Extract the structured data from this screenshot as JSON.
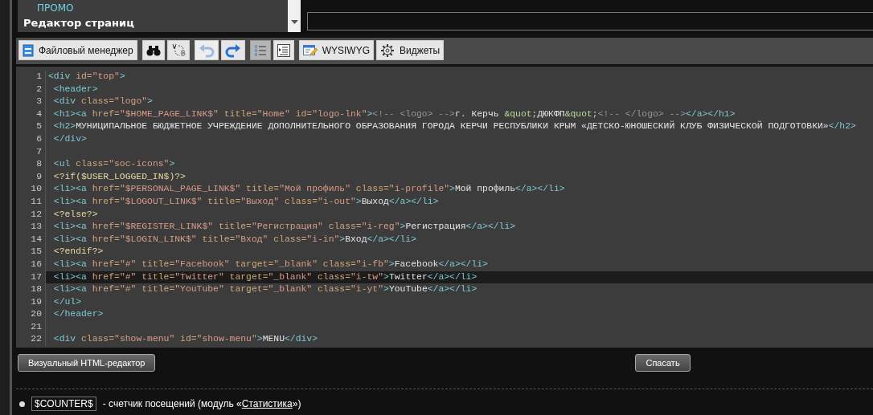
{
  "sidebar": {
    "items": [
      {
        "label": "ПРОМО",
        "kind": "link"
      },
      {
        "label": "Редактор страниц",
        "kind": "heading"
      }
    ]
  },
  "toolbar": [
    [
      {
        "label": "Файловый менеджер",
        "disabled": false,
        "pressed": false
      }
    ],
    [
      {
        "disabled": false,
        "pressed": false
      },
      {
        "disabled": false,
        "pressed": false
      }
    ],
    [
      {
        "disabled": true,
        "pressed": false
      },
      {
        "disabled": false,
        "pressed": false
      }
    ],
    [
      {
        "disabled": false,
        "pressed": true
      },
      {
        "disabled": false,
        "pressed": false
      }
    ],
    [
      {
        "label": "WYSIWYG",
        "disabled": false,
        "pressed": false
      },
      {
        "label": "Виджеты",
        "disabled": false,
        "pressed": false
      }
    ]
  ],
  "editor": {
    "lines": [
      {
        "number": "1",
        "selected": false,
        "tokens": [
          {
            "kind": "tag",
            "text": "<div"
          },
          {
            "kind": "attr",
            "text": " id="
          },
          {
            "kind": "string",
            "text": "\"top\""
          },
          {
            "kind": "tag",
            "text": ">"
          }
        ]
      },
      {
        "number": "2",
        "selected": false,
        "tokens": [
          {
            "kind": "tag",
            "text": " <header>"
          }
        ]
      },
      {
        "number": "3",
        "selected": false,
        "tokens": [
          {
            "kind": "tag",
            "text": " <div"
          },
          {
            "kind": "attr",
            "text": " class="
          },
          {
            "kind": "string",
            "text": "\"logo\""
          },
          {
            "kind": "tag",
            "text": ">"
          }
        ]
      },
      {
        "number": "4",
        "selected": false,
        "tokens": [
          {
            "kind": "tag",
            "text": " <h1><a"
          },
          {
            "kind": "attr",
            "text": " href="
          },
          {
            "kind": "string",
            "text": "\"$HOME_PAGE_LINK$\""
          },
          {
            "kind": "attr",
            "text": " title="
          },
          {
            "kind": "string",
            "text": "\"Home\""
          },
          {
            "kind": "attr",
            "text": " id="
          },
          {
            "kind": "string",
            "text": "\"logo-lnk\""
          },
          {
            "kind": "tag",
            "text": ">"
          },
          {
            "kind": "comment",
            "text": "<!-- <logo> -->"
          },
          {
            "kind": "text",
            "text": "г. Керчь "
          },
          {
            "kind": "entity",
            "text": "&quot;"
          },
          {
            "kind": "text",
            "text": "ДЮКФП"
          },
          {
            "kind": "entity",
            "text": "&quot;"
          },
          {
            "kind": "comment",
            "text": "<!-- </logo> -->"
          },
          {
            "kind": "tag",
            "text": "</a></h1>"
          }
        ]
      },
      {
        "number": "5",
        "selected": false,
        "tokens": [
          {
            "kind": "tag",
            "text": " <h2>"
          },
          {
            "kind": "text",
            "text": "МУНИЦИПАЛЬНОЕ БЮДЖЕТНОЕ УЧРЕЖДЕНИЕ ДОПОЛНИТЕЛЬНОГО ОБРАЗОВАНИЯ ГОРОДА КЕРЧИ РЕСПУБЛИКИ КРЫМ «ДЕТСКО-ЮНОШЕСКИЙ КЛУБ ФИЗИЧЕСКОЙ ПОДГОТОВКИ»"
          },
          {
            "kind": "tag",
            "text": "</h2>"
          }
        ]
      },
      {
        "number": "6",
        "selected": false,
        "tokens": [
          {
            "kind": "tag",
            "text": " </div>"
          }
        ]
      },
      {
        "number": "7",
        "selected": false
      },
      {
        "number": "8",
        "selected": false,
        "tokens": [
          {
            "kind": "tag",
            "text": " <ul"
          },
          {
            "kind": "attr",
            "text": " class="
          },
          {
            "kind": "string",
            "text": "\"soc-icons\""
          },
          {
            "kind": "tag",
            "text": ">"
          }
        ]
      },
      {
        "number": "9",
        "selected": false,
        "tokens": [
          {
            "kind": "php",
            "text": " <?if($USER_LOGGED_IN$)?>"
          }
        ]
      },
      {
        "number": "10",
        "selected": false,
        "tokens": [
          {
            "kind": "tag",
            "text": " <li><a"
          },
          {
            "kind": "attr",
            "text": " href="
          },
          {
            "kind": "string",
            "text": "\"$PERSONAL_PAGE_LINK$\""
          },
          {
            "kind": "attr",
            "text": " title="
          },
          {
            "kind": "string",
            "text": "\"Мой профиль\""
          },
          {
            "kind": "attr",
            "text": " class="
          },
          {
            "kind": "string",
            "text": "\"i-profile\""
          },
          {
            "kind": "tag",
            "text": ">"
          },
          {
            "kind": "text",
            "text": "Мой профиль"
          },
          {
            "kind": "tag",
            "text": "</a></li>"
          }
        ]
      },
      {
        "number": "11",
        "selected": false,
        "tokens": [
          {
            "kind": "tag",
            "text": " <li><a"
          },
          {
            "kind": "attr",
            "text": " href="
          },
          {
            "kind": "string",
            "text": "\"$LOGOUT_LINK$\""
          },
          {
            "kind": "attr",
            "text": " title="
          },
          {
            "kind": "string",
            "text": "\"Выход\""
          },
          {
            "kind": "attr",
            "text": " class="
          },
          {
            "kind": "string",
            "text": "\"i-out\""
          },
          {
            "kind": "tag",
            "text": ">"
          },
          {
            "kind": "text",
            "text": "Выход"
          },
          {
            "kind": "tag",
            "text": "</a></li>"
          }
        ]
      },
      {
        "number": "12",
        "selected": false,
        "tokens": [
          {
            "kind": "php",
            "text": " <?else?>"
          }
        ]
      },
      {
        "number": "13",
        "selected": false,
        "tokens": [
          {
            "kind": "tag",
            "text": " <li><a"
          },
          {
            "kind": "attr",
            "text": " href="
          },
          {
            "kind": "string",
            "text": "\"$REGISTER_LINK$\""
          },
          {
            "kind": "attr",
            "text": " title="
          },
          {
            "kind": "string",
            "text": "\"Регистрация\""
          },
          {
            "kind": "attr",
            "text": " class="
          },
          {
            "kind": "string",
            "text": "\"i-reg\""
          },
          {
            "kind": "tag",
            "text": ">"
          },
          {
            "kind": "text",
            "text": "Регистрация"
          },
          {
            "kind": "tag",
            "text": "</a></li>"
          }
        ]
      },
      {
        "number": "14",
        "selected": false,
        "tokens": [
          {
            "kind": "tag",
            "text": " <li><a"
          },
          {
            "kind": "attr",
            "text": " href="
          },
          {
            "kind": "string",
            "text": "\"$LOGIN_LINK$\""
          },
          {
            "kind": "attr",
            "text": " title="
          },
          {
            "kind": "string",
            "text": "\"Вход\""
          },
          {
            "kind": "attr",
            "text": " class="
          },
          {
            "kind": "string",
            "text": "\"i-in\""
          },
          {
            "kind": "tag",
            "text": ">"
          },
          {
            "kind": "text",
            "text": "Вход"
          },
          {
            "kind": "tag",
            "text": "</a></li>"
          }
        ]
      },
      {
        "number": "15",
        "selected": false,
        "tokens": [
          {
            "kind": "php",
            "text": " <?endif?>"
          }
        ]
      },
      {
        "number": "16",
        "selected": false,
        "tokens": [
          {
            "kind": "tag",
            "text": " <li><a"
          },
          {
            "kind": "attr",
            "text": " href="
          },
          {
            "kind": "string",
            "text": "\"#\""
          },
          {
            "kind": "attr",
            "text": " title="
          },
          {
            "kind": "string",
            "text": "\"Facebook\""
          },
          {
            "kind": "attr",
            "text": " target="
          },
          {
            "kind": "string",
            "text": "\"_blank\""
          },
          {
            "kind": "attr",
            "text": " class="
          },
          {
            "kind": "string",
            "text": "\"i-fb\""
          },
          {
            "kind": "tag",
            "text": ">"
          },
          {
            "kind": "text",
            "text": "Facebook"
          },
          {
            "kind": "tag",
            "text": "</a></li>"
          }
        ]
      },
      {
        "number": "17",
        "selected": true,
        "tokens": [
          {
            "kind": "tag",
            "text": " <li><a"
          },
          {
            "kind": "attr",
            "text": " href="
          },
          {
            "kind": "string",
            "text": "\"#\""
          },
          {
            "kind": "attr",
            "text": " title="
          },
          {
            "kind": "string",
            "text": "\"Twitter\""
          },
          {
            "kind": "attr",
            "text": " target="
          },
          {
            "kind": "string",
            "text": "\"_blank\""
          },
          {
            "kind": "attr",
            "text": " class="
          },
          {
            "kind": "string",
            "text": "\"i-tw\""
          },
          {
            "kind": "tag",
            "text": ">"
          },
          {
            "kind": "text",
            "text": "Twitter"
          },
          {
            "kind": "tag",
            "text": "</a></li>"
          }
        ]
      },
      {
        "number": "18",
        "selected": false,
        "tokens": [
          {
            "kind": "tag",
            "text": " <li><a"
          },
          {
            "kind": "attr",
            "text": " href="
          },
          {
            "kind": "string",
            "text": "\"#\""
          },
          {
            "kind": "attr",
            "text": " title="
          },
          {
            "kind": "string",
            "text": "\"YouTube\""
          },
          {
            "kind": "attr",
            "text": " target="
          },
          {
            "kind": "string",
            "text": "\"_blank\""
          },
          {
            "kind": "attr",
            "text": " class="
          },
          {
            "kind": "string",
            "text": "\"i-yt\""
          },
          {
            "kind": "tag",
            "text": ">"
          },
          {
            "kind": "text",
            "text": "YouTube"
          },
          {
            "kind": "tag",
            "text": "</a></li>"
          }
        ]
      },
      {
        "number": "19",
        "selected": false,
        "tokens": [
          {
            "kind": "tag",
            "text": " </ul>"
          }
        ]
      },
      {
        "number": "20",
        "selected": false,
        "tokens": [
          {
            "kind": "tag",
            "text": " </header>"
          }
        ]
      },
      {
        "number": "21",
        "selected": false
      },
      {
        "number": "22",
        "selected": false,
        "tokens": [
          {
            "kind": "tag",
            "text": " <div"
          },
          {
            "kind": "attr",
            "text": " class="
          },
          {
            "kind": "string",
            "text": "\"show-menu\""
          },
          {
            "kind": "attr",
            "text": " id="
          },
          {
            "kind": "string",
            "text": "\"show-menu\""
          },
          {
            "kind": "tag",
            "text": ">"
          },
          {
            "kind": "text",
            "text": "MENU"
          },
          {
            "kind": "tag",
            "text": "</div>"
          }
        ]
      }
    ]
  },
  "buttons": {
    "visual_editor": "Визуальный HTML-редактор",
    "save": "Спасать"
  },
  "variables": [
    {
      "code": "$COUNTER$",
      "description": "- счетчик посещений (модуль «",
      "link": "Статистика",
      "suffix": "»)"
    }
  ]
}
